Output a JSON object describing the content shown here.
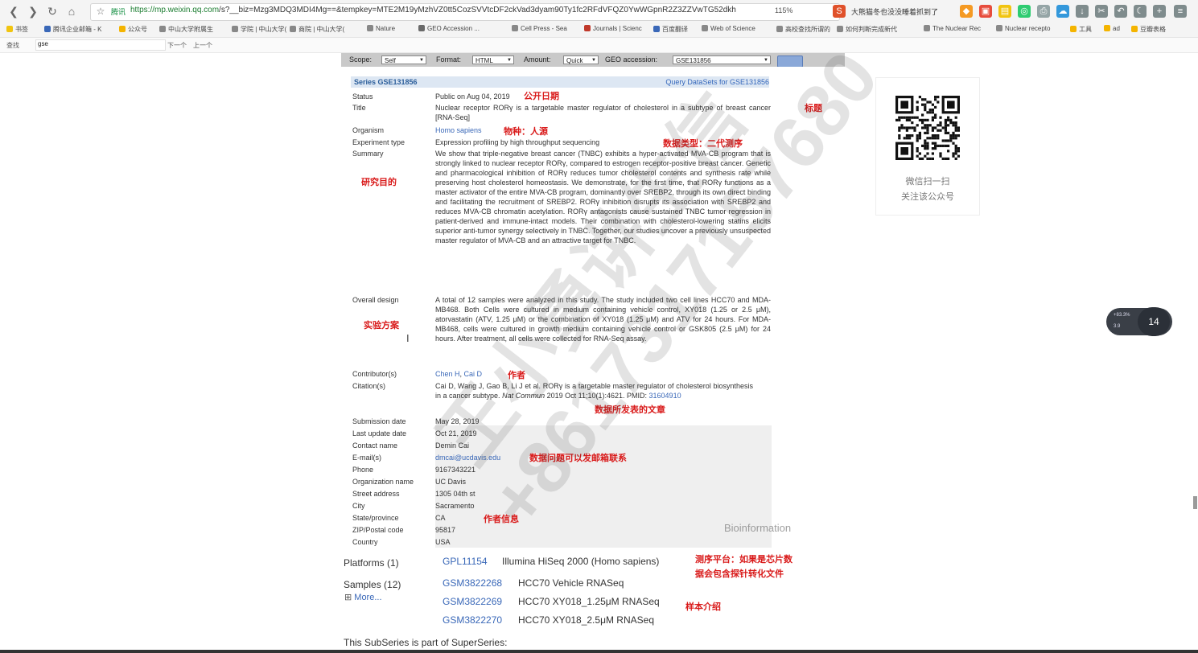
{
  "browser": {
    "url_secure_label": "腾讯",
    "url_host": "https://mp.weixin.qq.com",
    "url_path": "/s?__biz=Mzg3MDQ3MDI4Mg==&tempkey=MTE2M19yMzhVZ0tt5CozSVVtcDF2ckVad3dyam90Ty1fc2RFdVFQZ0YwWGpnR2Z3ZZVwTG52dkh",
    "zoom": "115%",
    "search_text": "大熊猫冬也没没睡着抓到了",
    "bookmarks": [
      "书签",
      "腾讯企业邮箱 - K",
      "公众号",
      "中山大学附属生",
      "学院 | 中山大学(",
      "商院 | 中山大学(",
      "Nature",
      "GEO Accession ...",
      "Cell Press - Sea",
      "Journals | Scienc",
      "百度翻译",
      "Web of Science",
      "高校查找所谓的",
      "如何判断完成新代",
      "The Nuclear Rec",
      "Nuclear recepto",
      "工具",
      "ad",
      "豆瓣表格"
    ],
    "find_label": "查找",
    "find_value": "gse",
    "find_next": "下一个",
    "find_prev": "上一个"
  },
  "geo_toolbar": {
    "scope_label": "Scope:",
    "scope_value": "Self",
    "format_label": "Format:",
    "format_value": "HTML",
    "amount_label": "Amount:",
    "amount_value": "Quick",
    "accession_label": "GEO accession:",
    "accession_value": "GSE131856",
    "go_label": "GO"
  },
  "series": {
    "header": "Series GSE131856",
    "query_link": "Query DataSets for GSE131856",
    "status_label": "Status",
    "status_value": "Public on Aug 04, 2019",
    "title_label": "Title",
    "title_value": "Nuclear receptor RORγ is a targetable master regulator of cholesterol in a subtype of breast cancer [RNA-Seq]",
    "organism_label": "Organism",
    "organism_value": "Homo sapiens",
    "exptype_label": "Experiment type",
    "exptype_value": "Expression profiling by high throughput sequencing",
    "summary_label": "Summary",
    "summary_value": "We show that triple-negative breast cancer (TNBC) exhibits a hyper-activated MVA-CB program that is strongly linked to nuclear receptor RORγ, compared to estrogen receptor-positive breast cancer. Genetic and pharmacological inhibition of RORγ reduces tumor cholesterol contents and synthesis rate while preserving host cholesterol homeostasis. We demonstrate, for the first time, that RORγ functions as a master activator of the entire MVA-CB program, dominantly over SREBP2, through its own direct binding and facilitating the recruitment of SREBP2. RORγ inhibition disrupts its association with SREBP2 and reduces MVA-CB chromatin acetylation. RORγ antagonists cause sustained TNBC tumor regression in patient-derived and immune-intact models. Their combination with cholesterol-lowering statins elicits superior anti-tumor synergy selectively in TNBC. Together, our studies uncover a previously unsuspected master regulator of MVA-CB and an attractive target for TNBC.",
    "design_label": "Overall design",
    "design_value": "A total of 12 samples were analyzed in this study. The study included two cell lines HCC70 and MDA-MB468. Both Cells were cultured in medium containing vehicle control, XY018 (1.25 or 2.5 μM), atorvastatin (ATV, 1.25 μM) or the combination of XY018 (1.25 μM) and ATV for 24 hours. For MDA-MB468, cells were cultured in growth medium containing vehicle control or GSK805 (2.5 μM) for 24 hours. After treatment, all cells were collected for RNA-Seq assay.",
    "contrib_label": "Contributor(s)",
    "contrib_1": "Chen H",
    "contrib_sep": ", ",
    "contrib_2": "Cai D",
    "citation_label": "Citation(s)",
    "citation_pre": "Cai D, Wang J, Gao B, Li J et al. RORγ is a targetable master regulator of cholesterol biosynthesis in a cancer subtype.",
    "citation_journal": "Nat Commun",
    "citation_post": "2019 Oct 11;10(1):4621. PMID:",
    "citation_pmid": "31604910",
    "submission_label": "Submission date",
    "submission_value": "May 28, 2019",
    "lastupdate_label": "Last update date",
    "lastupdate_value": "Oct 21, 2019",
    "contact_label": "Contact name",
    "contact_value": "Demin Cai",
    "email_label": "E-mail(s)",
    "email_value": "dmcai@ucdavis.edu",
    "phone_label": "Phone",
    "phone_value": "9167343221",
    "org_label": "Organization name",
    "org_value": "UC Davis",
    "street_label": "Street address",
    "street_value": "1305 04th st",
    "city_label": "City",
    "city_value": "Sacramento",
    "state_label": "State/province",
    "state_value": "CA",
    "zip_label": "ZIP/Postal code",
    "zip_value": "95817",
    "country_label": "Country",
    "country_value": "USA"
  },
  "annotations": {
    "release_date": "公开日期",
    "title": "标题",
    "species": "物种：人源",
    "data_type": "数据类型：二代测序",
    "purpose": "研究目的",
    "design": "实验方案",
    "authors": "作者",
    "article": "数据所发表的文章",
    "email": "数据问题可以发邮箱联系",
    "author_info": "作者信息",
    "platform_1": "测序平台：如果是芯片数",
    "platform_2": "据会包含探针转化文件",
    "samples": "样本介绍"
  },
  "lower": {
    "platforms_label": "Platforms (1)",
    "platform_id": "GPL11154",
    "platform_desc": "Illumina HiSeq 2000 (Homo sapiens)",
    "samples_label": "Samples (12)",
    "more_label": "More...",
    "samples": [
      {
        "id": "GSM3822268",
        "desc": "HCC70 Vehicle RNASeq"
      },
      {
        "id": "GSM3822269",
        "desc": "HCC70 XY018_1.25μM RNASeq"
      },
      {
        "id": "GSM3822270",
        "desc": "HCC70 XY018_2.5μM RNASeq"
      }
    ],
    "superseries_text": "This SubSeries is part of SuperSeries:"
  },
  "sidebar": {
    "qr_caption_1": "微信扫一扫",
    "qr_caption_2": "关注该公众号"
  },
  "video_float": {
    "badge": "14",
    "line1": "+83.3%",
    "line2": "3.9"
  },
  "watermark": {
    "name": "王小勇讲生信",
    "phone": "+8617317157680",
    "source": "Bioinformation"
  },
  "colors": {
    "annotation_red": "#d91a1a",
    "link_blue": "#3a68b8",
    "header_blue": "#dde7f3"
  }
}
